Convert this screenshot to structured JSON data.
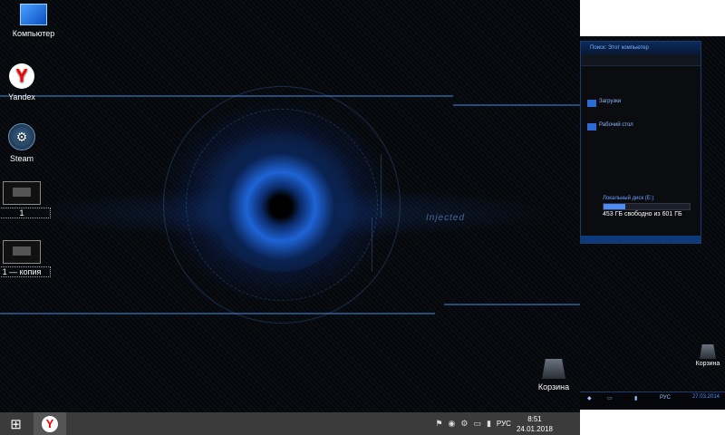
{
  "desktop_icons": [
    {
      "label": "Компьютер",
      "icon": "computer-icon"
    },
    {
      "label": "Yandex",
      "icon": "yandex-icon"
    },
    {
      "label": "Steam",
      "icon": "steam-icon"
    },
    {
      "label": "1",
      "icon": "image-thumbnail-icon"
    },
    {
      "label": "1 — копия",
      "icon": "image-thumbnail-icon"
    }
  ],
  "recycle_bin": {
    "label": "Корзина"
  },
  "wallpaper_text": "Injected",
  "taskbar": {
    "start_glyph": "⊞",
    "pinned_app": "Y",
    "language": "РУС",
    "time": "8:51",
    "date": "24.01.2018"
  },
  "preview": {
    "explorer_title": "Поиск: Этот компьютер",
    "folders": [
      {
        "label": "Загрузки"
      },
      {
        "label": "Рабочий стол"
      }
    ],
    "drive": {
      "name": "Локальный диск (E:)",
      "free_text": "453 ГБ свободно из 601 ГБ",
      "used_fraction": 0.25
    },
    "recycle_bin": "Корзина",
    "language": "РУС",
    "date": "27.03.2014"
  },
  "colors": {
    "accent": "#1e63d6",
    "taskbar": "#3b3b3b"
  }
}
